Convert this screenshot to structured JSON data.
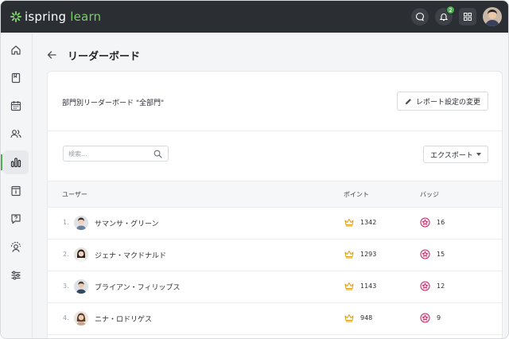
{
  "app": {
    "logo_brand": "ispring",
    "logo_product": "learn",
    "notification_count": "2"
  },
  "page": {
    "title": "リーダーボード"
  },
  "card": {
    "subtitle": "部門別リーダーボード \"全部門\"",
    "report_button": "レポート設定の変更",
    "search_placeholder": "検索...",
    "export_button": "エクスポート"
  },
  "table": {
    "columns": {
      "user": "ユーザー",
      "points": "ポイント",
      "badges": "バッジ"
    },
    "rows": [
      {
        "rank": "1.",
        "name": "サマンサ・グリーン",
        "points": "1342",
        "badges": "16"
      },
      {
        "rank": "2.",
        "name": "ジェナ・マクドナルド",
        "points": "1293",
        "badges": "15"
      },
      {
        "rank": "3.",
        "name": "ブライアン・フィリップス",
        "points": "1143",
        "badges": "12"
      },
      {
        "rank": "4.",
        "name": "ニナ・ロドリゲス",
        "points": "948",
        "badges": "9"
      }
    ]
  },
  "colors": {
    "topbar": "#2b2e33",
    "accent_green": "#4caf50",
    "crown": "#e0a31b",
    "badge": "#c2185b"
  },
  "icons": {
    "sidebar": [
      "home-icon",
      "book-icon",
      "calendar-icon",
      "users-icon",
      "chart-icon",
      "info-icon",
      "help-icon",
      "supervisor-icon",
      "settings-icon"
    ]
  }
}
